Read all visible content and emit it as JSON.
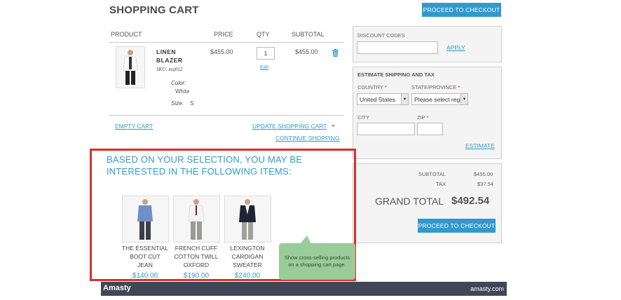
{
  "page": {
    "title": "SHOPPING CART",
    "checkout_label": "PROCEED TO CHECKOUT"
  },
  "table": {
    "headers": {
      "product": "PRODUCT",
      "price": "PRICE",
      "qty": "QTY",
      "subtotal": "SUBTOTAL"
    }
  },
  "item": {
    "name_line1": "LINEN",
    "name_line2": "BLAZER",
    "sku": "SKU: msj012",
    "price": "$455.00",
    "qty": "1",
    "edit_label": "Edit",
    "subtotal": "$455.00",
    "color_label": "Color:",
    "color_value": "White",
    "size_label": "Size:",
    "size_value": "S"
  },
  "cart_actions": {
    "empty": "EMPTY CART",
    "update": "UPDATE SHOPPING CART",
    "continue": "CONTINUE SHOPPING"
  },
  "discount": {
    "title": "DISCOUNT CODES",
    "apply": "APPLY"
  },
  "shipping": {
    "title": "ESTIMATE SHIPPING AND TAX",
    "country_label": "COUNTRY",
    "country_value": "United States",
    "state_label": "STATE/PROVINCE",
    "state_placeholder": "Please select region",
    "city_label": "CITY",
    "zip_label": "ZIP",
    "required_mark": "*",
    "estimate": "ESTIMATE"
  },
  "totals": {
    "subtotal_label": "SUBTOTAL",
    "subtotal_value": "$455.00",
    "tax_label": "TAX",
    "tax_value": "$37.54",
    "grand_label": "GRAND TOTAL",
    "grand_value": "$492.54",
    "checkout_label": "PROCEED TO CHECKOUT"
  },
  "cross_sell": {
    "title": "BASED ON YOUR SELECTION, YOU MAY BE INTERESTED IN THE FOLLOWING ITEMS:",
    "items": [
      {
        "line1": "THE ESSENTIAL",
        "line2": "BOOT CUT",
        "line3": "JEAN",
        "price": "$140.00"
      },
      {
        "line1": "FRENCH CUFF",
        "line2": "COTTON TWILL",
        "line3": "OXFORD",
        "price": "$190.00"
      },
      {
        "line1": "LEXINGTON",
        "line2": "CARDIGAN",
        "line3": "SWEATER",
        "price": "$240.00"
      }
    ]
  },
  "callout": {
    "line1": "Show cross-selling products",
    "line2": "on a shopping cart page."
  },
  "footer": {
    "logo": "Amasty",
    "domain": "amasty.com"
  },
  "colors": {
    "accent": "#3399cc",
    "highlight_border": "#d9302b",
    "callout_bg": "#99cc99",
    "footer_bg": "#414758"
  },
  "icons": {
    "trash": "trash-icon",
    "link": "link-icon"
  }
}
